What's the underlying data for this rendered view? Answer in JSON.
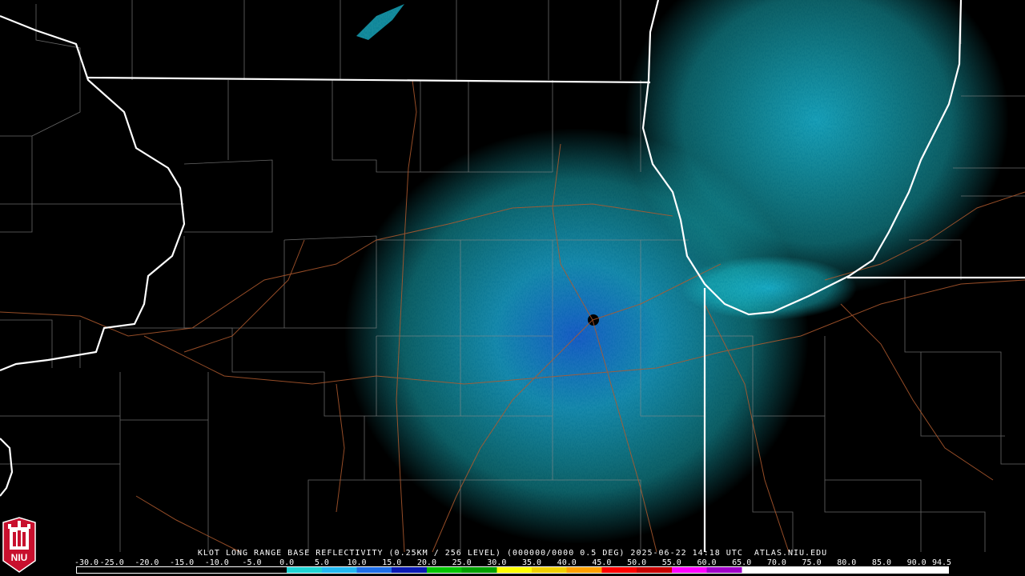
{
  "product": {
    "title": "KLOT LONG RANGE BASE REFLECTIVITY (0.25KM / 256 LEVEL) (000000/0000 0.5 DEG) 2025-06-22 14:18 UTC  ATLAS.NIU.EDU"
  },
  "logo": {
    "text": "NIU",
    "color": "#c8102e"
  },
  "scale": {
    "labels": [
      "-30.0",
      "-25.0",
      "-20.0",
      "-15.0",
      "-10.0",
      "-5.0",
      "0.0",
      "5.0",
      "10.0",
      "15.0",
      "20.0",
      "25.0",
      "30.0",
      "35.0",
      "40.0",
      "45.0",
      "50.0",
      "55.0",
      "60.0",
      "65.0",
      "70.0",
      "75.0",
      "80.0",
      "85.0",
      "90.0",
      "94.5"
    ],
    "colors": [
      {
        "from": -30,
        "to": 0,
        "color": "#000000"
      },
      {
        "from": 0,
        "to": 5,
        "color": "#1fd3d3"
      },
      {
        "from": 5,
        "to": 10,
        "color": "#22b8f0"
      },
      {
        "from": 10,
        "to": 15,
        "color": "#1e6ee8"
      },
      {
        "from": 15,
        "to": 20,
        "color": "#0a1ab4"
      },
      {
        "from": 20,
        "to": 25,
        "color": "#00c400"
      },
      {
        "from": 25,
        "to": 30,
        "color": "#00a000"
      },
      {
        "from": 30,
        "to": 35,
        "color": "#ffff00"
      },
      {
        "from": 35,
        "to": 40,
        "color": "#f0d000"
      },
      {
        "from": 40,
        "to": 45,
        "color": "#ffa000"
      },
      {
        "from": 45,
        "to": 50,
        "color": "#ff0000"
      },
      {
        "from": 50,
        "to": 55,
        "color": "#c80000"
      },
      {
        "from": 55,
        "to": 60,
        "color": "#ff00ff"
      },
      {
        "from": 60,
        "to": 65,
        "color": "#a000c8"
      },
      {
        "from": 65,
        "to": 70,
        "color": "#ffffff"
      },
      {
        "from": 70,
        "to": 94.5,
        "color": "#ffffff"
      }
    ]
  },
  "map_colors": {
    "state_border": "#ffffff",
    "county_line": "#8a8a8a",
    "road": "#b05a2e",
    "echo_light": "#1ed2e6",
    "echo_mid": "#1ea0e6",
    "echo_deep": "#1e5ee6"
  }
}
